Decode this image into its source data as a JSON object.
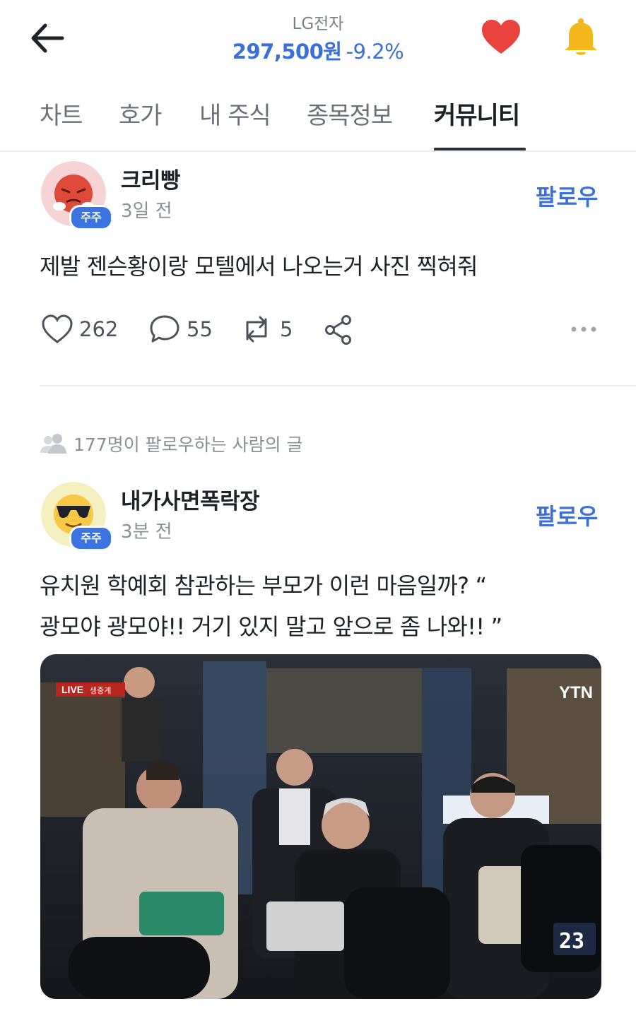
{
  "header": {
    "stock_name": "LG전자",
    "price": "297,500원",
    "change": "-9.2%",
    "colors": {
      "price": "#3d6fd8",
      "heart": "#e8413e",
      "bell": "#f5b81c"
    }
  },
  "tabs": [
    {
      "label": "차트"
    },
    {
      "label": "호가"
    },
    {
      "label": "내 주식"
    },
    {
      "label": "종목정보"
    },
    {
      "label": "커뮤니티",
      "active": true
    }
  ],
  "posts": [
    {
      "username": "크리빵",
      "badge": "주주",
      "time": "3일 전",
      "follow_label": "팔로우",
      "text": "제발 젠슨황이랑 모텔에서 나오는거 사진 찍혀줘",
      "likes": "262",
      "comments": "55",
      "reposts": "5",
      "avatar_icon": "angry-face-icon"
    },
    {
      "username": "내가사면폭락장",
      "badge": "주주",
      "time": "3분 전",
      "follow_label": "팔로우",
      "text_line1": "유치원 학예회 참관하는 부모가 이런 마음일까? “",
      "text_line2": "광모야 광모야!! 거기 있지 말고 앞으로 좀 나와!! ”",
      "avatar_icon": "sunglasses-face-icon",
      "image": {
        "live_label": "LIVE",
        "live_sub": "생중계",
        "broadcaster": "YTN",
        "number_tag": "23"
      }
    }
  ],
  "follow_note": "177명이 팔로우하는 사람의 글"
}
